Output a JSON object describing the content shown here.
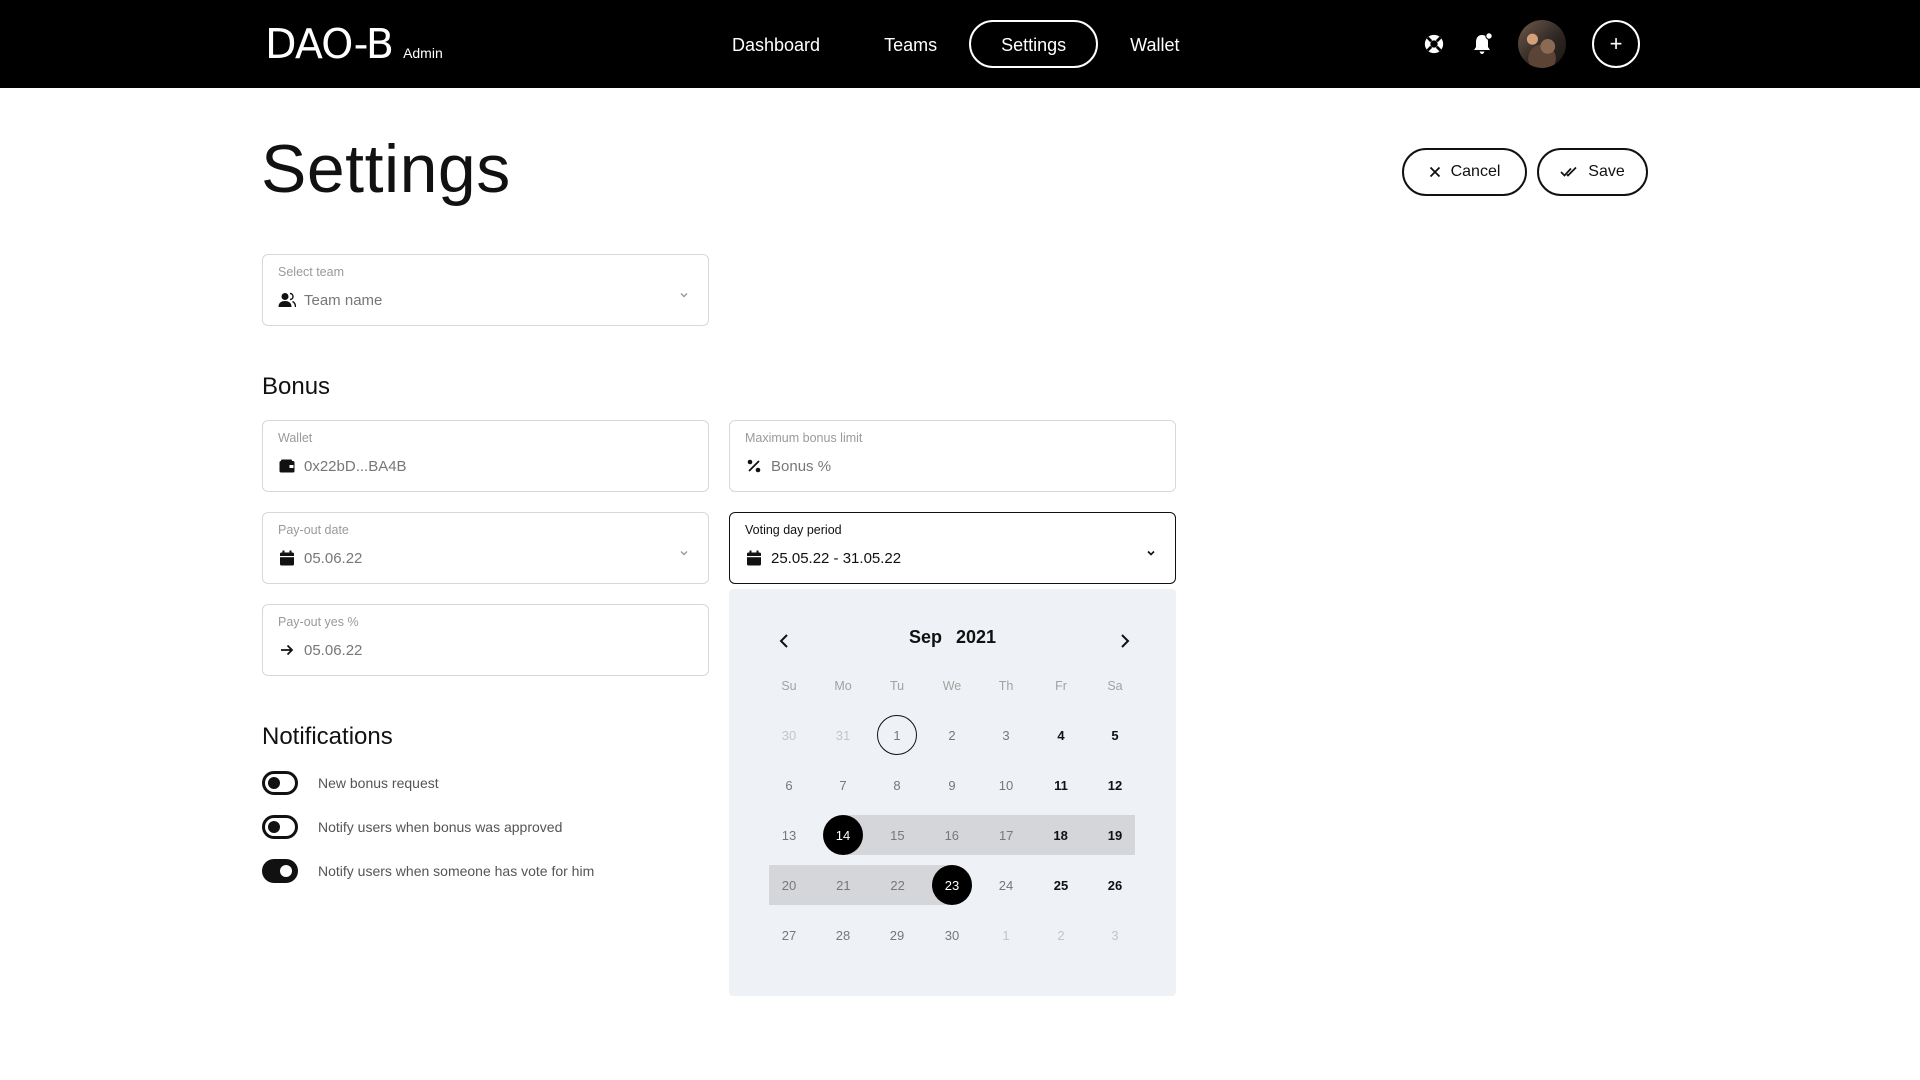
{
  "app": {
    "logo": "DAO-B",
    "role": "Admin"
  },
  "nav": {
    "items": [
      "Dashboard",
      "Teams",
      "Settings",
      "Wallet"
    ],
    "active": "Settings"
  },
  "header_icons": [
    "support-icon",
    "bell-icon",
    "avatar",
    "plus-icon"
  ],
  "page": {
    "title": "Settings"
  },
  "actions": {
    "cancel": "Cancel",
    "save": "Save"
  },
  "team": {
    "label": "Select team",
    "value": "Team name"
  },
  "bonus": {
    "title": "Bonus",
    "wallet": {
      "label": "Wallet",
      "value": "0x22bD...BA4B"
    },
    "max_limit": {
      "label": "Maximum bonus limit",
      "placeholder": "Bonus %"
    },
    "payout_date": {
      "label": "Pay-out date",
      "value": "05.06.22"
    },
    "voting_period": {
      "label": "Voting day period",
      "value": "25.05.22 - 31.05.22"
    },
    "payout_yes": {
      "label": "Pay-out yes %",
      "value": "05.06.22"
    }
  },
  "notifications": {
    "title": "Notifications",
    "items": [
      {
        "label": "New bonus request",
        "on": false
      },
      {
        "label": "Notify users when bonus was approved",
        "on": false
      },
      {
        "label": "Notify users when someone has vote for him",
        "on": true
      }
    ]
  },
  "calendar": {
    "month": "Sep",
    "year": "2021",
    "weekdays": [
      "Su",
      "Mo",
      "Tu",
      "We",
      "Th",
      "Fr",
      "Sa"
    ],
    "weeks": [
      [
        "30",
        "31",
        "1",
        "2",
        "3",
        "4",
        "5"
      ],
      [
        "6",
        "7",
        "8",
        "9",
        "10",
        "11",
        "12"
      ],
      [
        "13",
        "14",
        "15",
        "16",
        "17",
        "18",
        "19"
      ],
      [
        "20",
        "21",
        "22",
        "23",
        "24",
        "25",
        "26"
      ],
      [
        "27",
        "28",
        "29",
        "30",
        "1",
        "2",
        "3"
      ]
    ],
    "today": "1",
    "range_start": "14",
    "range_end": "23"
  },
  "colors": {
    "topbar": "#000000",
    "calendar_bg": "#eef1f6",
    "range_band": "#d4d6d9",
    "accent": "#000000"
  }
}
